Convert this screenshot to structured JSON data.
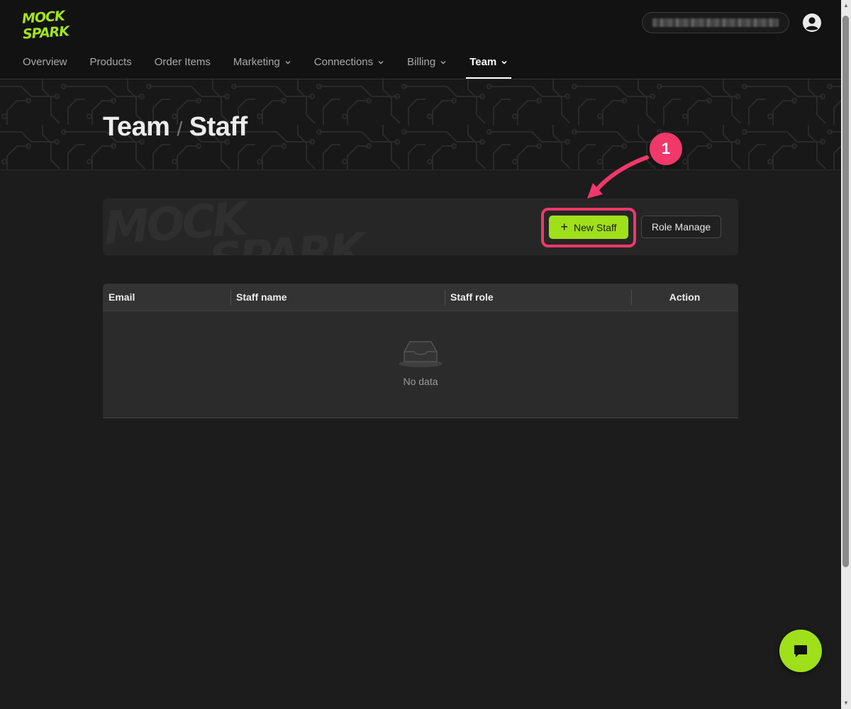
{
  "brand": {
    "logo_text": "MOCK SPARK",
    "accent": "#9fe01b"
  },
  "header": {
    "nav": [
      {
        "label": "Overview",
        "dropdown": false,
        "active": false
      },
      {
        "label": "Products",
        "dropdown": false,
        "active": false
      },
      {
        "label": "Order Items",
        "dropdown": false,
        "active": false
      },
      {
        "label": "Marketing",
        "dropdown": true,
        "active": false
      },
      {
        "label": "Connections",
        "dropdown": true,
        "active": false
      },
      {
        "label": "Billing",
        "dropdown": true,
        "active": false
      },
      {
        "label": "Team",
        "dropdown": true,
        "active": true
      }
    ]
  },
  "page": {
    "breadcrumb_parent": "Team",
    "breadcrumb_separator": "/",
    "title": "Staff"
  },
  "toolbar": {
    "new_staff_label": "New Staff",
    "role_manage_label": "Role Manage"
  },
  "annotation": {
    "step": "1",
    "color": "#f0386b"
  },
  "table": {
    "columns": [
      "Email",
      "Staff name",
      "Staff role",
      "Action"
    ],
    "rows": [],
    "empty_text": "No data"
  }
}
